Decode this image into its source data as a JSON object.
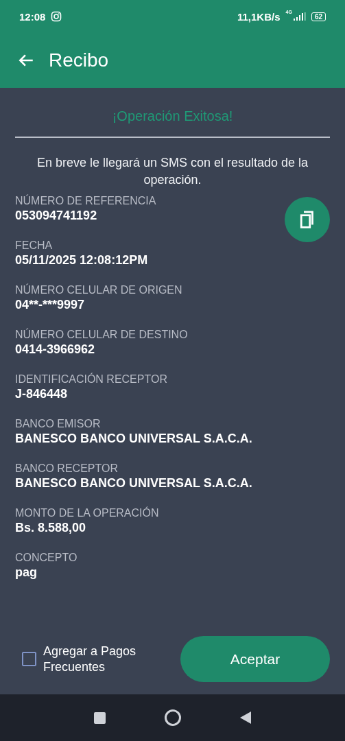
{
  "status_bar": {
    "time": "12:08",
    "speed": "11,1KB/s",
    "network": "4G",
    "battery": "62"
  },
  "app_bar": {
    "title": "Recibo"
  },
  "heading": "¡Operación Exitosa!",
  "message": "En breve le llegará un SMS con el resultado de la operación.",
  "fields": [
    {
      "label": "NÚMERO DE REFERENCIA",
      "value": "053094741192"
    },
    {
      "label": "FECHA",
      "value": "05/11/2025 12:08:12PM"
    },
    {
      "label": "NÚMERO CELULAR DE ORIGEN",
      "value": "04**-***9997"
    },
    {
      "label": "NÚMERO CELULAR DE DESTINO",
      "value": "0414-3966962"
    },
    {
      "label": "IDENTIFICACIÓN RECEPTOR",
      "value": "J-846448"
    },
    {
      "label": "BANCO EMISOR",
      "value": "BANESCO BANCO UNIVERSAL S.A.C.A."
    },
    {
      "label": "BANCO RECEPTOR",
      "value": "BANESCO BANCO UNIVERSAL S.A.C.A."
    },
    {
      "label": "MONTO DE LA OPERACIÓN",
      "value": "Bs. 8.588,00"
    },
    {
      "label": "CONCEPTO",
      "value": "pag"
    }
  ],
  "frequent": {
    "label": "Agregar a Pagos Frecuentes",
    "checked": false
  },
  "accept_button": "Aceptar"
}
